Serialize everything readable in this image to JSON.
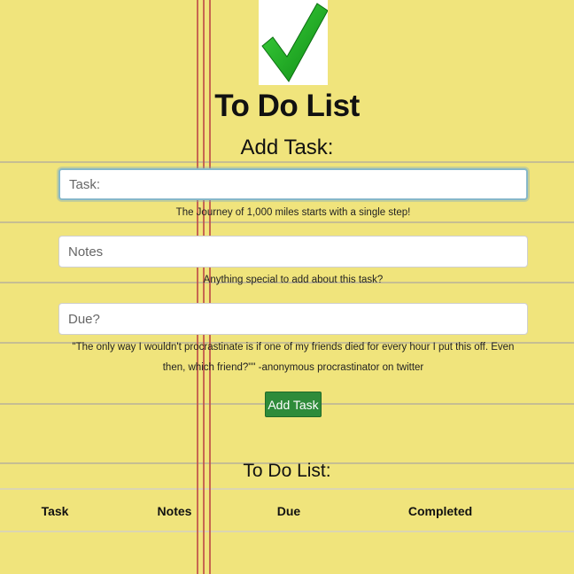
{
  "header": {
    "logo_icon": "checkmark-icon",
    "title": "To Do List"
  },
  "form": {
    "heading": "Add Task:",
    "task": {
      "placeholder": "Task:",
      "hint": "The Journey of 1,000 miles starts with a single step!"
    },
    "notes": {
      "placeholder": "Notes",
      "hint": "Anything special to add about this task?"
    },
    "due": {
      "placeholder": "Due?",
      "hint": "\"The only way I wouldn't procrastinate is if one of my friends died for every hour I put this off. Even then, which friend?\"\" -anonymous procrastinator on twitter"
    },
    "add_button_label": "Add Task"
  },
  "list": {
    "heading": "To Do List:",
    "columns": [
      "Task",
      "Notes",
      "Due",
      "Completed"
    ]
  },
  "colors": {
    "paper": "#f0e47c",
    "margin_line": "#c0504a",
    "rule_line": "#b8b19a",
    "button": "#2e8b3a",
    "check": "#1fa81f"
  }
}
